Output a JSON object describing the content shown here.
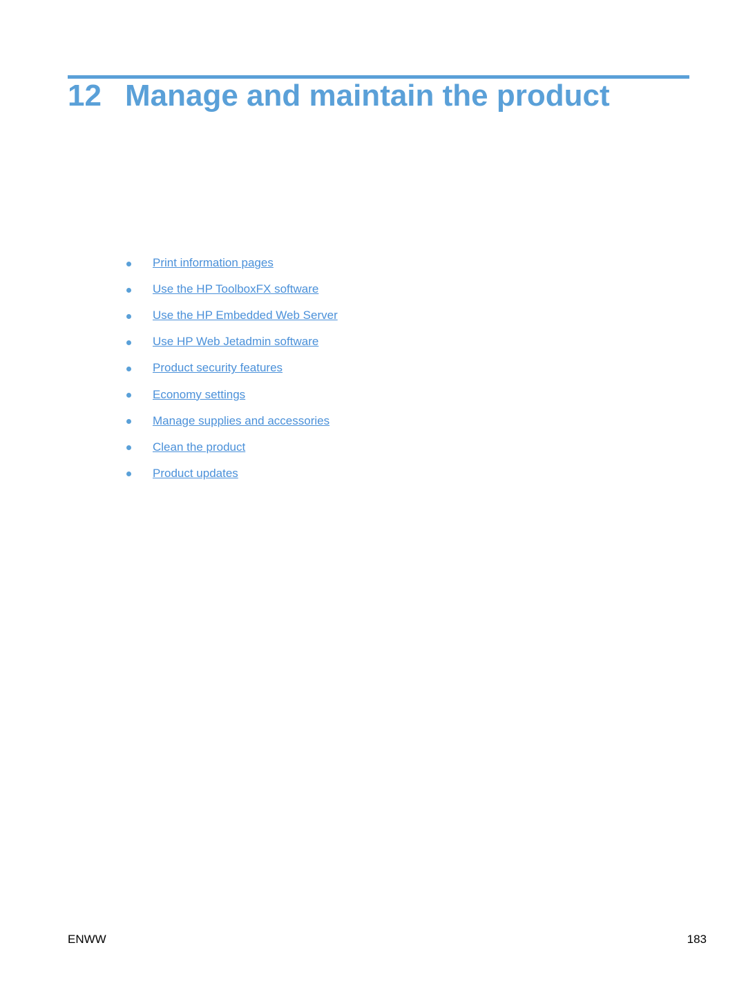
{
  "chapter": {
    "number": "12",
    "title": "Manage and maintain the product"
  },
  "links": [
    "Print information pages",
    "Use the HP ToolboxFX software",
    "Use the HP Embedded Web Server",
    "Use HP Web Jetadmin software",
    "Product security features",
    "Economy settings",
    "Manage supplies and accessories",
    "Clean the product",
    "Product updates"
  ],
  "footer": {
    "left": "ENWW",
    "page": "183"
  },
  "colors": {
    "accent": "#5aa0d8",
    "link": "#4a90d9"
  }
}
